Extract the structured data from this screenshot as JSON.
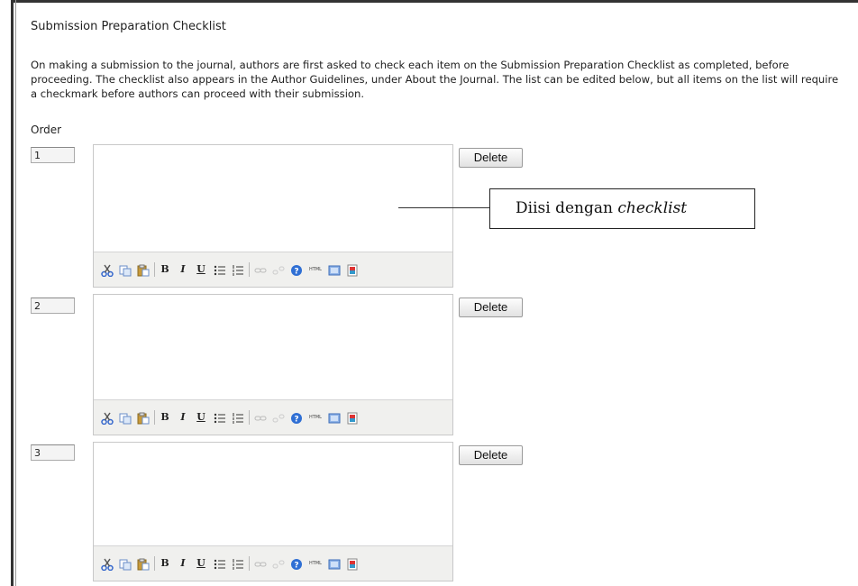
{
  "section": {
    "title": "Submission Preparation Checklist",
    "description": "On making a submission to the journal, authors are first asked to check each item on the Submission Preparation Checklist as completed, before proceeding. The checklist also appears in the Author Guidelines, under About the Journal. The list can be edited below, but all items on the list will require a checkmark before authors can proceed with their submission.",
    "order_label": "Order"
  },
  "checklist_items": [
    {
      "order": "1",
      "delete_label": "Delete"
    },
    {
      "order": "2",
      "delete_label": "Delete"
    },
    {
      "order": "3",
      "delete_label": "Delete"
    }
  ],
  "editor_toolbar": {
    "icons": [
      "cut-icon",
      "copy-icon",
      "paste-icon",
      "bold-icon",
      "italic-icon",
      "underline-icon",
      "bullet-list-icon",
      "numbered-list-icon",
      "link-icon",
      "unlink-icon",
      "help-icon",
      "html-icon",
      "fullscreen-icon",
      "image-icon"
    ],
    "bold_glyph": "B",
    "italic_glyph": "I",
    "underline_glyph": "U",
    "html_glyph": "HTML"
  },
  "annotation": {
    "prefix": "Diisi dengan ",
    "emphasis": "checklist"
  }
}
